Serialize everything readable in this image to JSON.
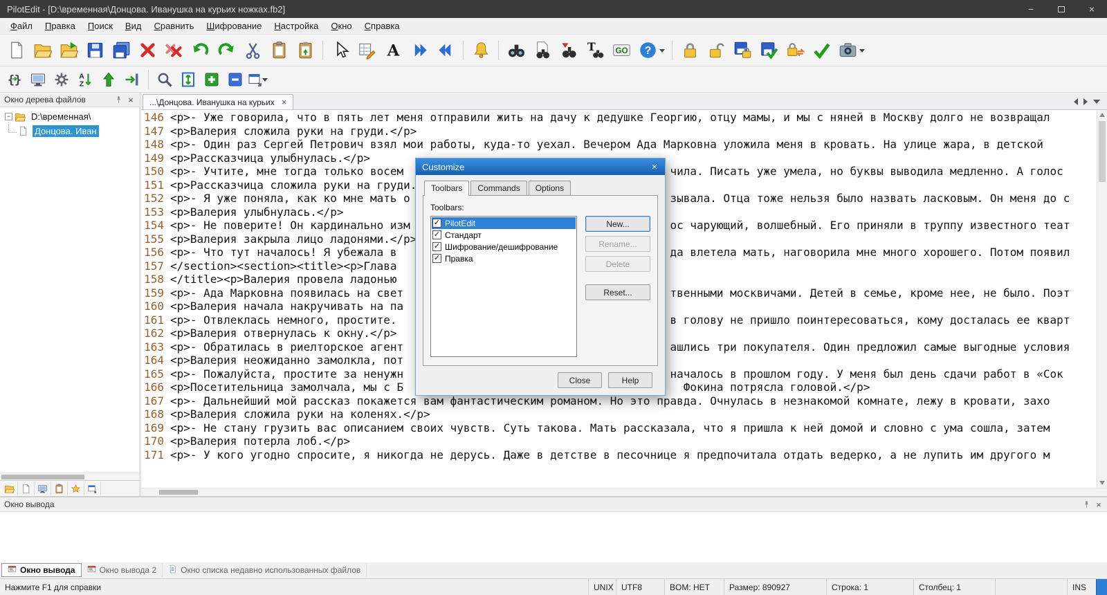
{
  "colors": {
    "titlebar": "#3a3a3a",
    "selection_blue": "#2f80d7",
    "tree_selection": "#2e95d3",
    "line_number": "#9a5f2a",
    "dialog_title_top": "#3b8ede",
    "dialog_title_bottom": "#1760b0"
  },
  "window": {
    "title": "PilotEdit - [D:\\временная\\Донцова. Иванушка на курьих ножках.fb2]"
  },
  "menu": {
    "items": [
      {
        "name": "menu-file",
        "label": "Файл"
      },
      {
        "name": "menu-edit",
        "label": "Правка"
      },
      {
        "name": "menu-search",
        "label": "Поиск"
      },
      {
        "name": "menu-view",
        "label": "Вид"
      },
      {
        "name": "menu-compare",
        "label": "Сравнить"
      },
      {
        "name": "menu-encryption",
        "label": "Шифрование"
      },
      {
        "name": "menu-settings",
        "label": "Настройка"
      },
      {
        "name": "menu-window",
        "label": "Окно"
      },
      {
        "name": "menu-help",
        "label": "Справка"
      }
    ]
  },
  "toolbar1": {
    "buttons": [
      {
        "name": "new-file-button",
        "kind": "page"
      },
      {
        "name": "open-file-button",
        "kind": "folder-open"
      },
      {
        "name": "open-remote-button",
        "kind": "folder-arrow"
      },
      {
        "name": "save-button",
        "kind": "floppy"
      },
      {
        "name": "save-all-button",
        "kind": "floppy-multi"
      },
      {
        "name": "close-file-button",
        "kind": "xmark"
      },
      {
        "name": "close-all-button",
        "kind": "xmark-multi"
      },
      {
        "name": "undo-button",
        "kind": "undo"
      },
      {
        "name": "redo-button",
        "kind": "redo"
      },
      {
        "name": "cut-button",
        "kind": "scissors"
      },
      {
        "name": "copy-button",
        "kind": "clipboard"
      },
      {
        "name": "paste-button",
        "kind": "clipboard-green"
      },
      {
        "sep": true
      },
      {
        "name": "select-mode-button",
        "kind": "cursor"
      },
      {
        "name": "column-mode-button",
        "kind": "grid-edit"
      },
      {
        "name": "font-button",
        "kind": "letter-a"
      },
      {
        "name": "next-position-button",
        "kind": "chevrons-right"
      },
      {
        "name": "previous-position-button",
        "kind": "chevrons-left"
      },
      {
        "sep": true
      },
      {
        "name": "reminder-button",
        "kind": "bell"
      },
      {
        "sep": true
      },
      {
        "name": "find-button",
        "kind": "binoculars"
      },
      {
        "name": "find-in-files-button",
        "kind": "binoculars-page"
      },
      {
        "name": "find-next-button",
        "kind": "binoculars-arrow"
      },
      {
        "name": "replace-button",
        "kind": "replace"
      },
      {
        "name": "goto-button",
        "kind": "go"
      },
      {
        "name": "help-button",
        "kind": "help",
        "dropdown": true
      },
      {
        "sep": true
      },
      {
        "name": "encrypt-file-button",
        "kind": "lock"
      },
      {
        "name": "decrypt-file-button",
        "kind": "unlock"
      },
      {
        "name": "save-encrypted-button",
        "kind": "floppy-lock"
      },
      {
        "name": "save-decrypted-button",
        "kind": "floppy-check"
      },
      {
        "name": "encrypted-transfer-button",
        "kind": "lock-swap"
      },
      {
        "name": "file-compare-button",
        "kind": "check-green"
      },
      {
        "name": "snapshot-button",
        "kind": "camera",
        "dropdown": true
      }
    ]
  },
  "toolbar2": {
    "buttons": [
      {
        "name": "format-text-button",
        "kind": "braces"
      },
      {
        "name": "file-monitor-button",
        "kind": "monitor"
      },
      {
        "name": "settings-button",
        "kind": "gear"
      },
      {
        "name": "sort-button",
        "kind": "sort-az"
      },
      {
        "name": "scroll-top-button",
        "kind": "arrow-up"
      },
      {
        "name": "goto-line-button",
        "kind": "arrow-line"
      },
      {
        "sep": true
      },
      {
        "name": "find-pair-button",
        "kind": "magnifier"
      },
      {
        "name": "fit-window-button",
        "kind": "fit-vertical"
      },
      {
        "name": "expand-all-button",
        "kind": "plus-box"
      },
      {
        "name": "collapse-all-button",
        "kind": "minus-box"
      },
      {
        "name": "window-layout-button",
        "kind": "window-drop",
        "dropdown": true
      }
    ]
  },
  "file_tree": {
    "title": "Окно дерева файлов",
    "root": "D:\\временная\\",
    "file": "Донцова. Иван",
    "tabs": [
      {
        "name": "tree-tab-files",
        "kind": "folder-open"
      },
      {
        "name": "tree-tab-documents",
        "kind": "page"
      },
      {
        "name": "tree-tab-ftp",
        "kind": "monitor"
      },
      {
        "name": "tree-tab-clip",
        "kind": "clipboard"
      },
      {
        "name": "tree-tab-favorites",
        "kind": "star"
      },
      {
        "name": "tree-tab-windows",
        "kind": "window-drop"
      }
    ]
  },
  "editor": {
    "tab": "...\\Донцова. Иванушка на курьих",
    "tab_close": "×",
    "lines": [
      {
        "n": 146,
        "text": "<p>- Уже говорила, что в пять лет меня отправили жить на дачу к дедушке Георгию, отцу мамы, и мы с няней в Москву долго не возвращал"
      },
      {
        "n": 147,
        "text": "<p>Валерия сложила руки на груди.</p>"
      },
      {
        "n": 148,
        "text": "<p>- Один раз Сергей Петрович взял мои работы, куда-то уехал. Вечером Ада Марковна уложила меня в кровать. На улице жара, в детской"
      },
      {
        "n": 149,
        "text": "<p>Рассказчица улыбнулась.</p>"
      },
      {
        "n": 150,
        "text": "<p>- Учтите, мне тогда только восем                                        чила. Писать уже умела, но буквы выводила медленно. А голос"
      },
      {
        "n": 151,
        "text": "<p>Рассказчица сложила руки на груди.</p>"
      },
      {
        "n": 152,
        "text": "<p>- Я уже поняла, как ко мне мать о                                       зывала. Отца тоже нельзя было назвать ласковым. Он меня до с"
      },
      {
        "n": 153,
        "text": "<p>Валерия улыбнулась.</p>"
      },
      {
        "n": 154,
        "text": "<p>- Не поверите! Он кардинально изм                                       ос чарующий, волшебный. Его приняли в труппу известного теат"
      },
      {
        "n": 155,
        "text": "<p>Валерия закрыла лицо ладонями.</p>"
      },
      {
        "n": 156,
        "text": "<p>- Что тут началось! Я убежала в                                         да влетела мать, наговорила мне много хорошего. Потом появил"
      },
      {
        "n": 157,
        "text": "</section><section><title><p>Глава "
      },
      {
        "n": 158,
        "text": "</title><p>Валерия провела ладонью "
      },
      {
        "n": 159,
        "text": "<p>- Ада Марковна появилась на свет                                        твенными москвичами. Детей в семье, кроме нее, не было. Поэт"
      },
      {
        "n": 160,
        "text": "<p>Валерия начала накручивать на па"
      },
      {
        "n": 161,
        "text": "<p>- Отвлеклась немного, простите.                                         в голову не пришло поинтересоваться, кому досталась ее кварт"
      },
      {
        "n": 162,
        "text": "<p>Валерия отвернулась к окну.</p>"
      },
      {
        "n": 163,
        "text": "<p>- Обратилась в риелторское агент                                        ашлись три покупателя. Один предложил самые выгодные условия"
      },
      {
        "n": 164,
        "text": "<p>Валерия неожиданно замолкла, пот"
      },
      {
        "n": 165,
        "text": "<p>- Пожалуйста, простите за ненужн                                        началось в прошлом году. У меня был день сдачи работ в «Сок"
      },
      {
        "n": 166,
        "text": "<p>Посетительница замолчала, мы с Б                                          Фокина потрясла головой.</p>"
      },
      {
        "n": 167,
        "text": "<p>- Дальнейший мой рассказ покажется вам фантастическим романом. Но это правда. Очнулась в незнакомой комнате, лежу в кровати, захо"
      },
      {
        "n": 168,
        "text": "<p>Валерия сложила руки на коленях.</p>"
      },
      {
        "n": 169,
        "text": "<p>- Не стану грузить вас описанием своих чувств. Суть такова. Мать рассказала, что я пришла к ней домой и словно с ума сошла, затем"
      },
      {
        "n": 170,
        "text": "<p>Валерия потерла лоб.</p>"
      },
      {
        "n": 171,
        "text": "<p>- У кого угодно спросите, я никогда не дерусь. Даже в детстве в песочнице я предпочитала отдать ведерко, а не лупить им другого м"
      }
    ]
  },
  "dialog": {
    "title": "Customize",
    "close": "×",
    "tabs": [
      {
        "name": "dialog-tab-toolbars",
        "label": "Toolbars",
        "active": true
      },
      {
        "name": "dialog-tab-commands",
        "label": "Commands",
        "active": false
      },
      {
        "name": "dialog-tab-options",
        "label": "Options",
        "active": false
      }
    ],
    "caption": "Toolbars:",
    "toolbars_list": [
      {
        "label": "PilotEdit",
        "checked": true,
        "selected": true
      },
      {
        "label": "Стандарт",
        "checked": true,
        "selected": false
      },
      {
        "label": "Шифрование/дешифрование",
        "checked": true,
        "selected": false
      },
      {
        "label": "Правка",
        "checked": true,
        "selected": false
      }
    ],
    "buttons": {
      "new": "New...",
      "rename": "Rename...",
      "delete": "Delete",
      "reset": "Reset...",
      "close": "Close",
      "help": "Help"
    }
  },
  "output": {
    "title": "Окно вывода",
    "tabs": [
      {
        "name": "output-tab-1",
        "icon": "out-window",
        "label": "Окно вывода",
        "active": true
      },
      {
        "name": "output-tab-2",
        "icon": "out-window",
        "label": "Окно вывода 2",
        "active": false
      },
      {
        "name": "output-tab-recent",
        "icon": "page-list",
        "label": "Окно списка недавно использованных файлов",
        "active": false
      }
    ]
  },
  "status": {
    "segments": [
      {
        "name": "status-hint",
        "label": "Нажмите F1 для справки"
      },
      {
        "name": "status-eol",
        "label": "UNIX"
      },
      {
        "name": "status-encoding",
        "label": "UTF8"
      },
      {
        "name": "status-bom",
        "label": "BOM: НЕТ"
      },
      {
        "name": "status-size",
        "label": "Размер: 890927"
      },
      {
        "name": "status-line",
        "label": "Строка: 1"
      },
      {
        "name": "status-col",
        "label": "Столбец: 1"
      },
      {
        "name": "status-blank",
        "label": ""
      },
      {
        "name": "status-ins",
        "label": "INS"
      },
      {
        "name": "status-corner",
        "label": ""
      }
    ]
  }
}
